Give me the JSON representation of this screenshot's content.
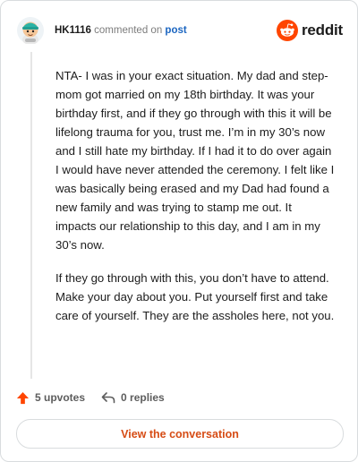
{
  "comment": {
    "username": "HK1116",
    "action_text": "commented on",
    "post_link": "post",
    "paragraphs": [
      "NTA- I was in your exact situation. My dad and step-mom got married on my 18th birthday. It was your birthday first, and if they go through with this it will be lifelong trauma for you, trust me. I’m in my 30’s now and I still hate my birthday. If I had it to do over again I would have never attended the ceremony. I felt like I was basically being erased and my Dad had found a new family and was trying to stamp me out. It impacts our relationship to this day, and I am in my 30’s now.",
      "If they go through with this, you don’t have to attend. Make your day about you. Put yourself first and take care of yourself. They are the assholes here, not you."
    ],
    "upvotes_label": "5 upvotes",
    "replies_label": "0 replies"
  },
  "brand": {
    "wordmark": "reddit",
    "color": "#ff4500"
  },
  "footer": {
    "conversation_button": "View the conversation"
  },
  "icons": [
    "avatar",
    "reddit-logo-icon",
    "upvote-arrow-icon",
    "reply-arrow-icon"
  ]
}
